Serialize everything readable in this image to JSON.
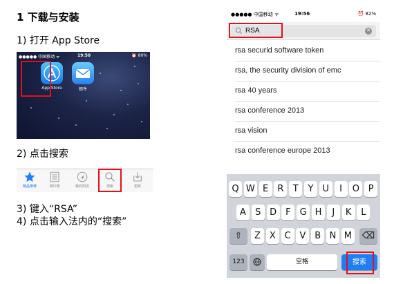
{
  "title": "1 下载与安装",
  "steps": {
    "step1": "1) 打开 App Store",
    "step2": "2) 点击搜索",
    "step3": "3) 键入“RSA”",
    "step4": "4) 点击输入法内的“搜索”"
  },
  "home_screen": {
    "status": {
      "carrier": "●●●●● 中国移动 ᯤ",
      "time": "19:50",
      "battery": "⏰ 80%"
    },
    "apps": [
      {
        "label": "App Store",
        "icon": "app-store-icon"
      },
      {
        "label": "邮件",
        "icon": "mail-icon"
      }
    ]
  },
  "tab_bar": {
    "tabs": [
      {
        "label": "精品推荐",
        "icon": "star-icon"
      },
      {
        "label": "排行榜",
        "icon": "list-icon"
      },
      {
        "label": "我的附近",
        "icon": "location-icon"
      },
      {
        "label": "搜索",
        "icon": "search-icon"
      },
      {
        "label": "更新",
        "icon": "update-icon"
      }
    ]
  },
  "search_screen": {
    "status": {
      "carrier": "●●●●● 中国移动 ᯤ",
      "time": "19:56",
      "battery": "⏰ 82%"
    },
    "query": "RSA",
    "suggestions": [
      "rsa securid software token",
      "rsa, the security division of emc",
      "rsa 40 years",
      "rsa conference 2013",
      "rsa vision",
      "rsa conference europe 2013"
    ],
    "keyboard": {
      "row1": [
        "Q",
        "W",
        "E",
        "R",
        "T",
        "Y",
        "U",
        "I",
        "O",
        "P"
      ],
      "row2": [
        "A",
        "S",
        "D",
        "F",
        "G",
        "H",
        "J",
        "K",
        "L"
      ],
      "row3": [
        "Z",
        "X",
        "C",
        "V",
        "B",
        "N",
        "M"
      ],
      "shift": "⇧",
      "delete": "⌫",
      "numbers": "123",
      "space": "空格",
      "search": "搜索"
    }
  },
  "colors": {
    "highlight": "#e3101b",
    "ios_blue": "#1e7ef5"
  }
}
